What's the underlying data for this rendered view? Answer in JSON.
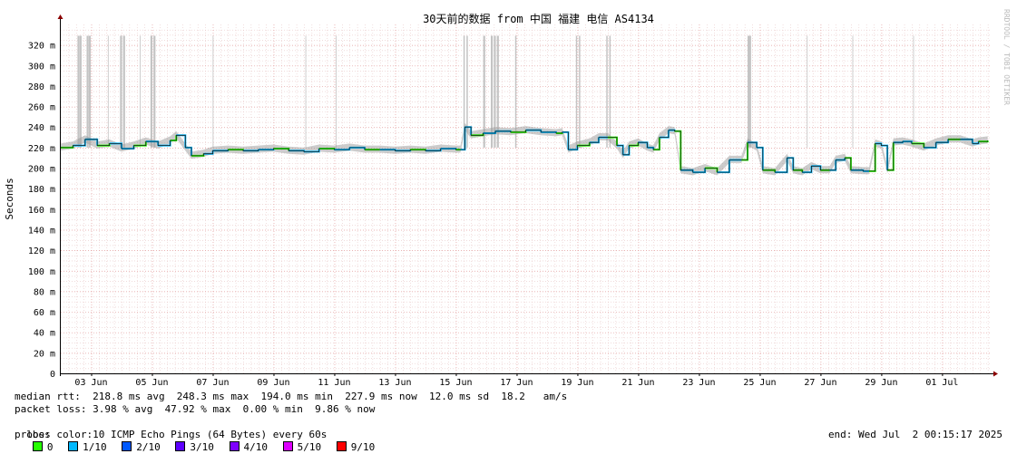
{
  "chart_data": {
    "type": "line",
    "title": "30天前的数据 from 中国 福建 电信 AS4134",
    "ylabel": "Seconds",
    "ylim": [
      0,
      340
    ],
    "y_ticks": [
      "0",
      "20 m",
      "40 m",
      "60 m",
      "80 m",
      "100 m",
      "120 m",
      "140 m",
      "160 m",
      "180 m",
      "200 m",
      "220 m",
      "240 m",
      "260 m",
      "280 m",
      "300 m",
      "320 m"
    ],
    "x_ticks": [
      "03 Jun",
      "05 Jun",
      "07 Jun",
      "09 Jun",
      "11 Jun",
      "13 Jun",
      "15 Jun",
      "17 Jun",
      "19 Jun",
      "21 Jun",
      "23 Jun",
      "25 Jun",
      "27 Jun",
      "29 Jun",
      "01 Jul"
    ],
    "x_range_days": [
      0,
      30.6
    ],
    "grid": true,
    "median_series": [
      [
        0.0,
        220
      ],
      [
        0.4,
        222
      ],
      [
        0.8,
        228
      ],
      [
        1.2,
        222
      ],
      [
        1.6,
        224
      ],
      [
        2.0,
        219
      ],
      [
        2.4,
        222
      ],
      [
        2.8,
        226
      ],
      [
        3.2,
        222
      ],
      [
        3.6,
        227
      ],
      [
        3.8,
        232
      ],
      [
        4.1,
        220
      ],
      [
        4.3,
        212
      ],
      [
        4.7,
        214
      ],
      [
        5.0,
        217
      ],
      [
        5.5,
        218
      ],
      [
        6.0,
        217
      ],
      [
        6.5,
        218
      ],
      [
        7.0,
        219
      ],
      [
        7.5,
        217
      ],
      [
        8.0,
        216
      ],
      [
        8.5,
        219
      ],
      [
        9.0,
        218
      ],
      [
        9.5,
        220
      ],
      [
        10.0,
        218
      ],
      [
        10.5,
        218
      ],
      [
        11.0,
        217
      ],
      [
        11.5,
        218
      ],
      [
        12.0,
        217
      ],
      [
        12.5,
        219
      ],
      [
        13.0,
        218
      ],
      [
        13.15,
        218
      ],
      [
        13.3,
        240
      ],
      [
        13.5,
        232
      ],
      [
        13.9,
        234
      ],
      [
        14.3,
        236
      ],
      [
        14.8,
        235
      ],
      [
        15.3,
        237
      ],
      [
        15.8,
        235
      ],
      [
        16.3,
        234
      ],
      [
        16.5,
        235
      ],
      [
        16.7,
        218
      ],
      [
        17.0,
        222
      ],
      [
        17.4,
        225
      ],
      [
        17.7,
        230
      ],
      [
        18.0,
        230
      ],
      [
        18.3,
        222
      ],
      [
        18.5,
        213
      ],
      [
        18.7,
        222
      ],
      [
        19.0,
        225
      ],
      [
        19.3,
        220
      ],
      [
        19.5,
        218
      ],
      [
        19.7,
        230
      ],
      [
        20.0,
        237
      ],
      [
        20.2,
        236
      ],
      [
        20.4,
        198
      ],
      [
        20.8,
        196
      ],
      [
        21.2,
        200
      ],
      [
        21.6,
        196
      ],
      [
        22.0,
        208
      ],
      [
        22.4,
        208
      ],
      [
        22.6,
        225
      ],
      [
        22.9,
        220
      ],
      [
        23.1,
        198
      ],
      [
        23.5,
        196
      ],
      [
        23.9,
        210
      ],
      [
        24.1,
        198
      ],
      [
        24.4,
        196
      ],
      [
        24.7,
        202
      ],
      [
        25.0,
        198
      ],
      [
        25.3,
        198
      ],
      [
        25.5,
        208
      ],
      [
        25.8,
        210
      ],
      [
        26.0,
        198
      ],
      [
        26.4,
        197
      ],
      [
        26.6,
        197
      ],
      [
        26.8,
        224
      ],
      [
        27.0,
        222
      ],
      [
        27.2,
        198
      ],
      [
        27.4,
        225
      ],
      [
        27.7,
        226
      ],
      [
        28.0,
        224
      ],
      [
        28.4,
        220
      ],
      [
        28.8,
        225
      ],
      [
        29.2,
        228
      ],
      [
        29.6,
        228
      ],
      [
        30.0,
        224
      ],
      [
        30.2,
        226
      ],
      [
        30.5,
        227
      ]
    ],
    "loss_spikes_days": [
      0.55,
      0.62,
      0.85,
      0.92,
      1.55,
      1.95,
      2.05,
      2.6,
      2.95,
      3.05,
      5.0,
      8.05,
      9.05,
      13.25,
      13.35,
      13.9,
      14.15,
      14.25,
      14.35,
      14.95,
      16.95,
      17.05,
      17.95,
      18.05,
      22.6,
      22.65,
      24.55,
      26.05,
      28.05
    ],
    "loss_spike_heights": [
      329,
      329,
      329,
      329,
      329,
      329,
      329,
      329,
      329,
      329,
      329,
      329,
      329,
      329,
      329,
      329,
      329,
      329,
      329,
      329,
      329,
      329,
      329,
      329,
      329,
      329,
      329,
      329,
      329
    ],
    "loss_spike_widths": [
      2.2,
      2.2,
      2.2,
      2.2,
      0.8,
      2.2,
      2.2,
      0.8,
      2.2,
      2.2,
      0.8,
      0.8,
      0.8,
      1.5,
      1.5,
      2.2,
      2.2,
      2.2,
      2.2,
      1.5,
      1.5,
      1.5,
      1.5,
      1.5,
      2.2,
      2.2,
      0.8,
      0.8,
      0.8
    ]
  },
  "stats": {
    "median_rtt": "median rtt:  218.8 ms avg  248.3 ms max  194.0 ms min  227.9 ms now  12.0 ms sd  18.2   am/s",
    "packet_loss": "packet loss: 3.98 % avg  47.92 % max  0.00 % min  9.86 % now",
    "loss_color_label": "loss color:",
    "probe": "probe:       10 ICMP Echo Pings (64 Bytes) every 60s",
    "end": "end: Wed Jul  2 00:15:17 2025"
  },
  "loss_colors": [
    {
      "label": "0",
      "color": "#26ff00"
    },
    {
      "label": "1/10",
      "color": "#00b8ff"
    },
    {
      "label": "2/10",
      "color": "#0059ff"
    },
    {
      "label": "3/10",
      "color": "#5e00ff"
    },
    {
      "label": "4/10",
      "color": "#7e00ff"
    },
    {
      "label": "5/10",
      "color": "#dd00ff"
    },
    {
      "label": "9/10",
      "color": "#ff0000"
    }
  ],
  "watermark": "RRDTOOL / TOBI OETIKER"
}
